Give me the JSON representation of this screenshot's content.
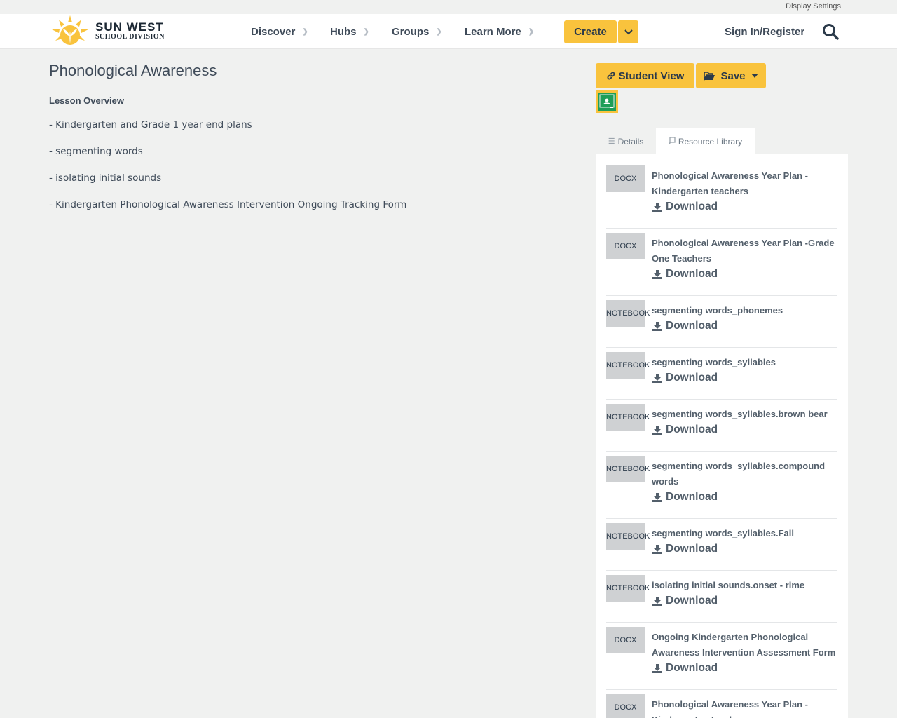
{
  "utility": {
    "display_settings": "Display Settings"
  },
  "header": {
    "logo_line1": "SUN WEST",
    "logo_line2": "SCHOOL DIVISION",
    "nav": [
      {
        "label": "Discover"
      },
      {
        "label": "Hubs"
      },
      {
        "label": "Groups"
      },
      {
        "label": "Learn More"
      }
    ],
    "create_label": "Create",
    "sign_in_label": "Sign In/Register"
  },
  "lesson": {
    "title": "Phonological Awareness",
    "overview_heading": "Lesson Overview",
    "overview_items": [
      "- Kindergarten and Grade 1 year end plans",
      "- segmenting words",
      "- isolating initial sounds",
      "- Kindergarten Phonological Awareness Intervention Ongoing Tracking Form"
    ]
  },
  "actions": {
    "student_view_label": "Student View",
    "save_label": "Save"
  },
  "tabs": {
    "details_label": "Details",
    "library_label": "Resource Library"
  },
  "colors": {
    "accent": "#f9c33d",
    "text": "#3f4b59",
    "classroom_green": "#1e9e57"
  },
  "resources": [
    {
      "type": "DOCX",
      "title": "Phonological Awareness Year Plan - Kindergarten teachers",
      "download_label": "Download"
    },
    {
      "type": "DOCX",
      "title": "Phonological Awareness Year Plan -Grade One Teachers",
      "download_label": "Download"
    },
    {
      "type": "NOTEBOOK",
      "title": "segmenting words_phonemes",
      "download_label": "Download"
    },
    {
      "type": "NOTEBOOK",
      "title": "segmenting words_syllables",
      "download_label": "Download"
    },
    {
      "type": "NOTEBOOK",
      "title": "segmenting words_syllables.brown bear",
      "download_label": "Download"
    },
    {
      "type": "NOTEBOOK",
      "title": "segmenting words_syllables.compound words",
      "download_label": "Download"
    },
    {
      "type": "NOTEBOOK",
      "title": "segmenting words_syllables.Fall",
      "download_label": "Download"
    },
    {
      "type": "NOTEBOOK",
      "title": "isolating initial sounds.onset - rime",
      "download_label": "Download"
    },
    {
      "type": "DOCX",
      "title": "Ongoing Kindergarten Phonological Awareness Intervention Assessment Form",
      "download_label": "Download"
    },
    {
      "type": "DOCX",
      "title": "Phonological Awareness Year Plan - Kindergarten teachers",
      "download_label": ""
    }
  ]
}
